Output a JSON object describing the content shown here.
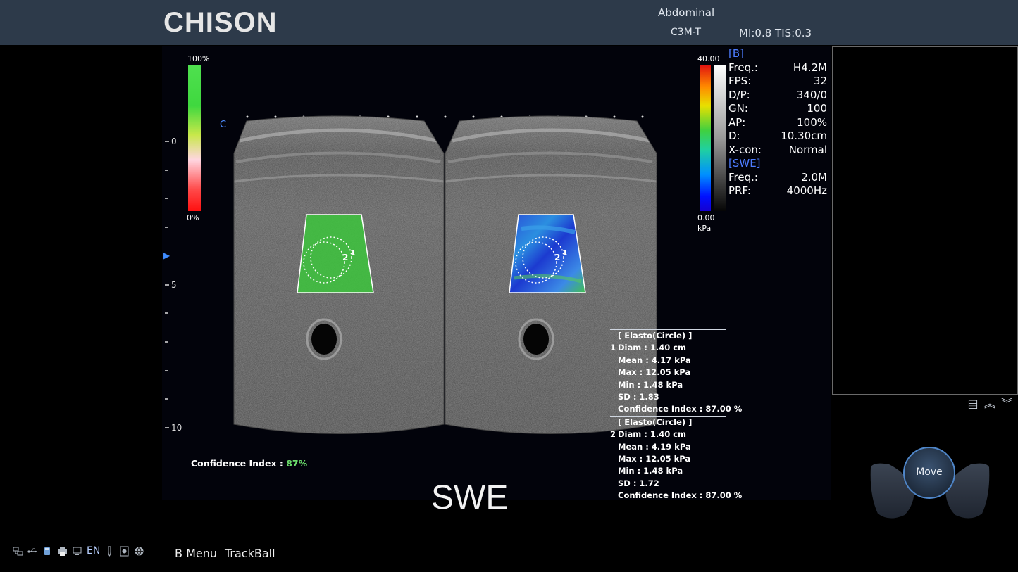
{
  "header": {
    "brand": "CHISON",
    "preset": "Abdominal",
    "probe": "C3M-T",
    "mi_tis": "MI:0.8 TIS:0.3"
  },
  "left_scale": {
    "top": "100%",
    "bottom": "0%",
    "colors": [
      "#4fe04f",
      "#c8e84a",
      "#ffd6e0",
      "#ff1010"
    ]
  },
  "depth": {
    "marks": [
      "0",
      "5",
      "10"
    ],
    "focus_marker": "▶",
    "label": "C"
  },
  "kpa_scale": {
    "max": "40.00",
    "min": "0.00",
    "unit": "kPa"
  },
  "params": {
    "b_header": "[B]",
    "b": [
      {
        "label": "Freq.:",
        "value": "H4.2M"
      },
      {
        "label": "FPS:",
        "value": "32"
      },
      {
        "label": "D/P:",
        "value": "340/0"
      },
      {
        "label": "GN:",
        "value": "100"
      },
      {
        "label": "AP:",
        "value": "100%"
      },
      {
        "label": "D:",
        "value": "10.30cm"
      },
      {
        "label": "X-con:",
        "value": "Normal"
      }
    ],
    "swe_header": "[SWE]",
    "swe": [
      {
        "label": "Freq.:",
        "value": "2.0M"
      },
      {
        "label": "PRF:",
        "value": "4000Hz"
      }
    ]
  },
  "measurements": [
    {
      "title": "[ Elasto(Circle) ]",
      "id": "1",
      "diam": "Diam :  1.40 cm",
      "mean": "Mean :  4.17 kPa",
      "max": "Max :  12.05 kPa",
      "min": "Min :  1.48 kPa",
      "sd": "SD :  1.83",
      "ci": "Confidence Index :  87.00 %"
    },
    {
      "title": "[ Elasto(Circle) ]",
      "id": "2",
      "diam": "Diam :  1.40 cm",
      "mean": "Mean :  4.19 kPa",
      "max": "Max :  12.05 kPa",
      "min": "Min :  1.48 kPa",
      "sd": "SD :  1.72",
      "ci": "Confidence Index :  87.00 %"
    }
  ],
  "roi_labels": [
    "2",
    "1"
  ],
  "confidence": {
    "label": "Confidence Index : ",
    "value": "87%"
  },
  "mode": "SWE",
  "trackball": {
    "label": "Move"
  },
  "statusbar": {
    "lang": "EN",
    "menu_b": "B Menu",
    "menu_trackball": "TrackBall"
  }
}
